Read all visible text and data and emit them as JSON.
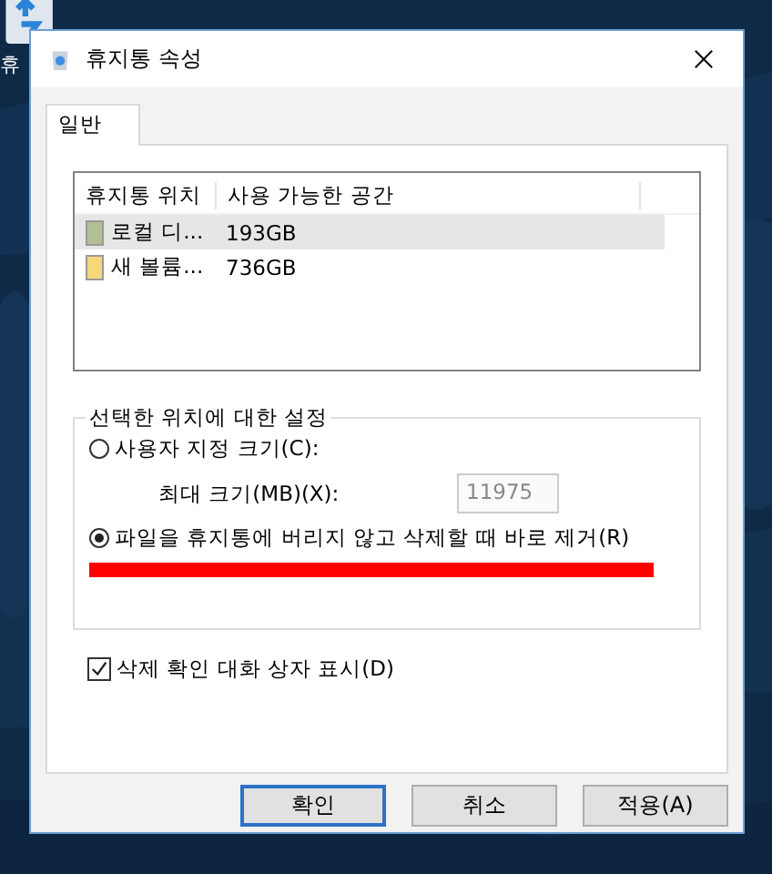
{
  "desktop_icon": {
    "label": "휴"
  },
  "window": {
    "title": "휴지통 속성"
  },
  "tabs": [
    {
      "label": "일반",
      "selected": true
    }
  ],
  "table": {
    "columns": [
      "휴지통 위치",
      "사용 가능한 공간"
    ],
    "rows": [
      {
        "name": "로컬 디...",
        "space": "193GB",
        "selected": true,
        "color": "#b2bf94"
      },
      {
        "name": "새 볼륨...",
        "space": "736GB",
        "selected": false,
        "color": "#f5d878"
      }
    ]
  },
  "settings": {
    "title": "선택한 위치에 대한 설정",
    "options": [
      {
        "label": "사용자 지정 크기(C):",
        "selected": false
      },
      {
        "label": "파일을 휴지통에 버리지 않고 삭제할 때 바로 제거(R)",
        "selected": true
      }
    ],
    "max_size": {
      "label": "최대 크기(MB)(X):",
      "value": "11975",
      "disabled": true
    }
  },
  "confirm_checkbox": {
    "label": "삭제 확인 대화 상자 표시(D)",
    "checked": true
  },
  "buttons": [
    {
      "label": "확인",
      "default": true
    },
    {
      "label": "취소",
      "default": false
    },
    {
      "label": "적용(A)",
      "default": false
    }
  ]
}
